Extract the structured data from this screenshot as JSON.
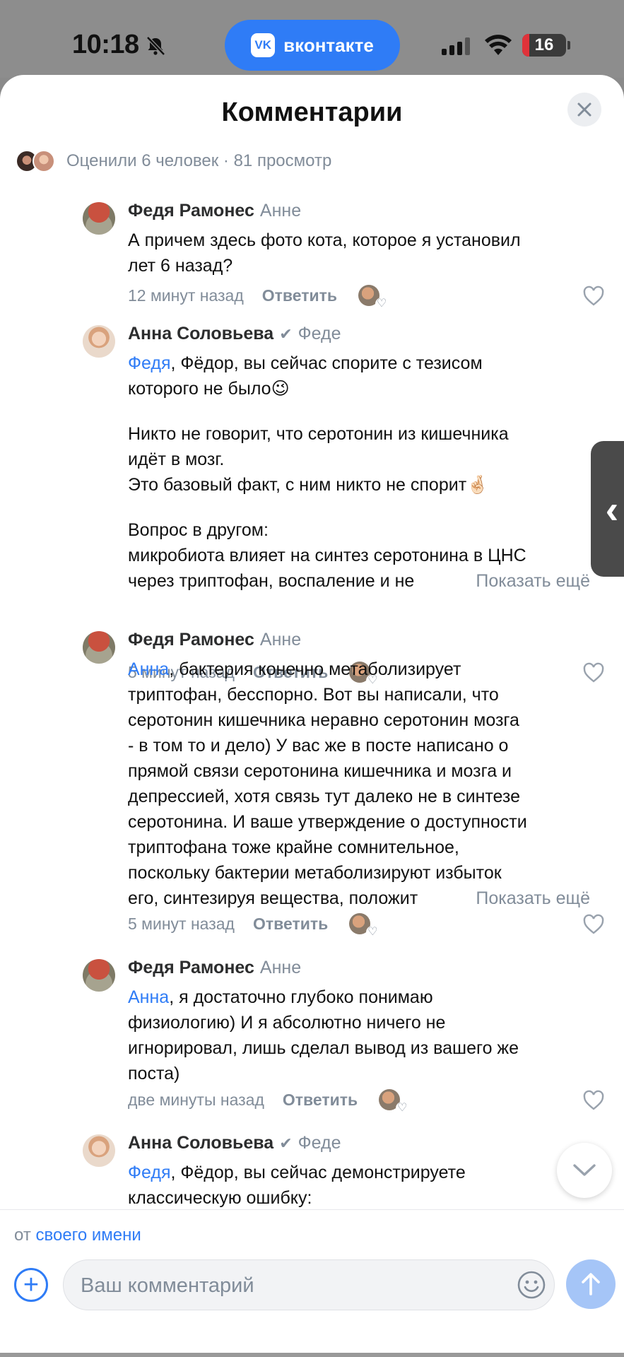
{
  "status_bar": {
    "time": "10:18",
    "battery": "16",
    "app_pill": "вконтакте",
    "vk_logo": "VK"
  },
  "sheet": {
    "title": "Комментарии",
    "likes_summary": "Оценили 6 человек · 81 просмотр"
  },
  "comments": [
    {
      "author": "Федя Рамонес",
      "reply_to": "Анне",
      "lines": [
        "А причем здесь фото кота, которое я установил",
        "лет 6 назад?"
      ],
      "time": "12 минут назад",
      "reply_label": "Ответить"
    },
    {
      "author": "Анна Соловьева",
      "reply_to": "Феде",
      "mention": "Федя",
      "line1_rest": ", Фёдор, вы сейчас спорите с тезисом",
      "line2": "которого не было😉",
      "para2": [
        "Никто не говорит, что серотонин из кишечника",
        "идёт в мозг.",
        "Это базовый факт, с ним никто не спорит🤞🏻"
      ],
      "para3": [
        "Вопрос в другом:",
        "микробиота влияет на синтез серотонина в ЦНС"
      ],
      "last_line": "через триптофан, воспаление и не",
      "show_more": "Показать ещё",
      "time": "5 минут назад",
      "reply_label": "Ответить"
    },
    {
      "author": "Федя Рамонес",
      "reply_to": "Анне",
      "mention": "Анна",
      "line1_rest": ", бактерия конечно метаболизирует",
      "lines": [
        "триптофан, бесспорно. Вот вы написали, что",
        "серотонин кишечника неравно серотонин мозга",
        "- в том то и дело) У вас же в посте написано о",
        "прямой связи серотонина кишечника и мозга и",
        "депрессией, хотя связь тут далеко не в синтезе",
        "серотонина. И ваше утверждение о доступности",
        "триптофана тоже крайне сомнительное,",
        "поскольку бактерии метаболизируют избыток"
      ],
      "last_line": "его, синтезируя вещества, положит",
      "show_more": "Показать ещё",
      "time": "5 минут назад",
      "reply_label": "Ответить"
    },
    {
      "author": "Федя Рамонес",
      "reply_to": "Анне",
      "mention": "Анна",
      "line1_rest": ", я достаточно глубоко понимаю",
      "lines": [
        "физиологию) И я абсолютно ничего не",
        "игнорировал, лишь сделал вывод из вашего же",
        "поста)"
      ],
      "time": "две минуты назад",
      "reply_label": "Ответить"
    },
    {
      "author": "Анна Соловьева",
      "reply_to": "Феде",
      "mention": "Федя",
      "line1_rest": ", Фёдор, вы сейчас демонстрируете",
      "lines": [
        "классическую ошибку:"
      ]
    }
  ],
  "composer": {
    "from_prefix": "от",
    "from_link": "своего имени",
    "placeholder": "Ваш комментарий"
  },
  "icons": {
    "bell": "bell-slash-icon",
    "close": "close-icon",
    "verified": "checkmark-icon",
    "heart": "heart-outline-icon",
    "add": "plus-circle-icon",
    "emoji": "smile-icon",
    "send": "arrow-up-icon",
    "scroll": "chevron-down-icon",
    "side_tab": "chevron-left-icon"
  },
  "colors": {
    "accent": "#2f7cf6",
    "secondary_text": "#818c99",
    "send_disabled": "#a5c5f7"
  }
}
